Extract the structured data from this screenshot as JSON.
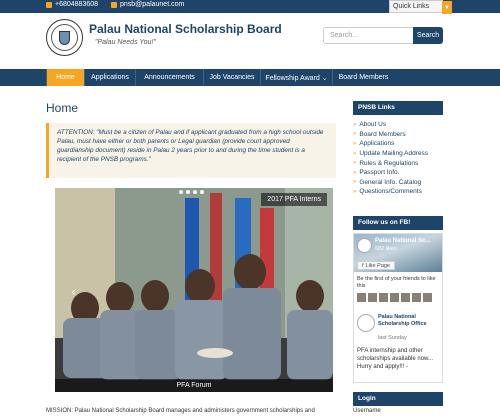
{
  "topbar": {
    "phone": "+6804883608",
    "email": "pnsb@palaunet.com",
    "quick_links": "Quick Links"
  },
  "header": {
    "title": "Palau National Scholarship Board",
    "tagline": "\"Palau Needs You!\"",
    "search_placeholder": "Search...",
    "search_button": "Search"
  },
  "nav": {
    "items": [
      {
        "label": "Home",
        "active": true
      },
      {
        "label": "Applications"
      },
      {
        "label": "Announcements"
      },
      {
        "label": "Job Vacancies"
      },
      {
        "label": "Fellowship Award ⌄"
      },
      {
        "label": "Board Members"
      }
    ]
  },
  "main": {
    "page_title": "Home",
    "attention": "ATTENTION: \"Must be a citizen of Palau and if applicant graduated from a high school outside Palau, must have either or both parents or Legal guardian (provide court approved guardianship document) reside in Palau 2 years prior to and during the time student is a recipient of the PNSB programs.\"",
    "slider_top_caption": "2017 PFA Interns",
    "slider_bottom_caption": "PFA Forum",
    "mission": "MISSION: Palau National Scholarship Board manages and administers government scholarships and"
  },
  "sidebar": {
    "links_heading": "PNSB Links",
    "links": [
      "About Us",
      "Board Members",
      "Applications",
      "Update Mailing Address",
      "Rules & Regulations",
      "Passport Info.",
      "General Info. Catalog",
      "Questions/Comments"
    ],
    "fb_heading": "Follow us on FB!",
    "fb": {
      "page_name": "Palau National Sc...",
      "likes": "682 likes",
      "like_button": "Like Page",
      "friends_text": "Be the first of your friends to like this",
      "post_name": "Palau National Scholarship Office",
      "post_time": "last Sunday",
      "post_text": "PFA internship and other scholarships available now... Hurry and apply!!! -"
    },
    "login_heading": "Login",
    "login_username": "Username"
  }
}
